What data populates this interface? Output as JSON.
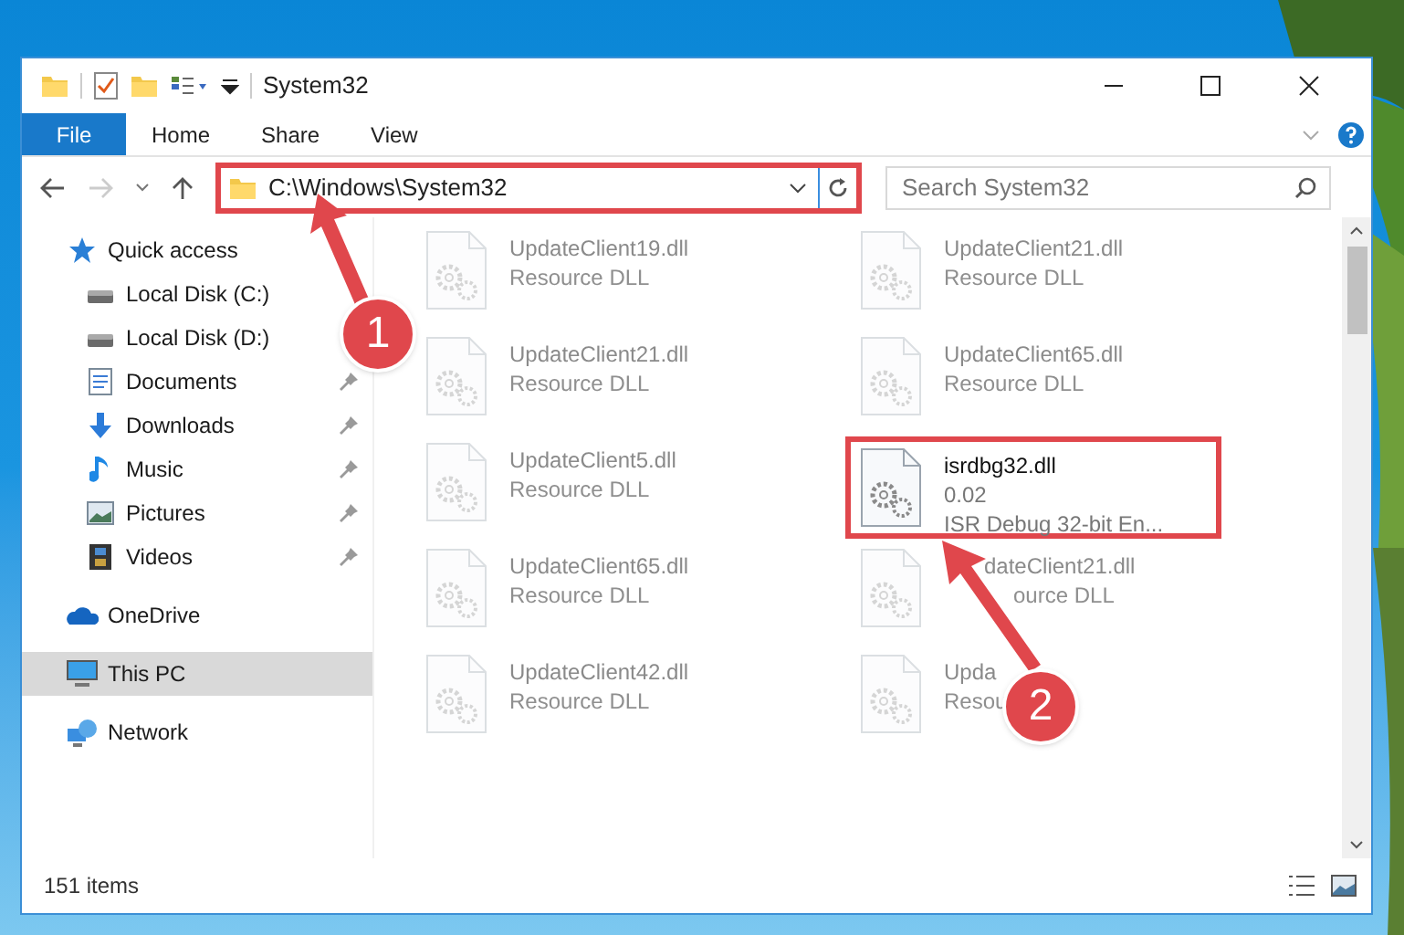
{
  "window": {
    "title": "System32"
  },
  "ribbon": {
    "tabs": [
      {
        "label": "File",
        "kind": "file"
      },
      {
        "label": "Home",
        "kind": "tab"
      },
      {
        "label": "Share",
        "kind": "tab"
      },
      {
        "label": "View",
        "kind": "tab"
      }
    ]
  },
  "address_bar": {
    "path": "C:\\Windows\\System32",
    "highlighted": true
  },
  "search": {
    "placeholder": "Search System32"
  },
  "sidebar": {
    "items": [
      {
        "label": "Quick access",
        "kind": "star",
        "selected": false,
        "children": [
          {
            "label": "Local Disk (C:)",
            "kind": "disk",
            "selected": false
          },
          {
            "label": "Local Disk (D:)",
            "kind": "disk",
            "selected": false
          },
          {
            "label": "Documents",
            "kind": "documents",
            "pinned": true,
            "selected": false
          },
          {
            "label": "Downloads",
            "kind": "downloads",
            "pinned": true,
            "selected": false
          },
          {
            "label": "Music",
            "kind": "music",
            "pinned": true,
            "selected": false
          },
          {
            "label": "Pictures",
            "kind": "pictures",
            "pinned": true,
            "selected": false
          },
          {
            "label": "Videos",
            "kind": "videos",
            "pinned": true,
            "selected": false
          }
        ]
      },
      {
        "label": "OneDrive",
        "kind": "cloud",
        "selected": false
      },
      {
        "label": "This PC",
        "kind": "pc",
        "selected": true
      },
      {
        "label": "Network",
        "kind": "network",
        "selected": false
      }
    ]
  },
  "files": [
    {
      "name": "UpdateClient19.dll",
      "description": "Resource DLL",
      "blurred": true,
      "highlighted": false
    },
    {
      "name": "UpdateClient21.dll",
      "description": "Resource DLL",
      "blurred": true,
      "highlighted": false
    },
    {
      "name": "UpdateClient21.dll",
      "description": "Resource DLL",
      "blurred": true,
      "highlighted": false
    },
    {
      "name": "UpdateClient65.dll",
      "description": "Resource DLL",
      "blurred": true,
      "highlighted": false
    },
    {
      "name": "UpdateClient5.dll",
      "description": "Resource DLL",
      "blurred": true,
      "highlighted": false
    },
    {
      "name": "isrdbg32.dll",
      "version": "0.02",
      "description": "ISR Debug 32-bit En...",
      "blurred": false,
      "highlighted": true
    },
    {
      "name": "UpdateClient65.dll",
      "description": "Resource DLL",
      "blurred": true,
      "highlighted": false
    },
    {
      "name": "dateClient21.dll",
      "description": "ource DLL",
      "blurred": true,
      "highlighted": false,
      "kind": "covered"
    },
    {
      "name": "UpdateClient42.dll",
      "description": "Resource DLL",
      "blurred": true,
      "highlighted": false
    },
    {
      "name": "Upda",
      "description": "Resou",
      "blurred": true,
      "highlighted": false
    }
  ],
  "status_bar": {
    "count": "151 items"
  },
  "callouts": [
    {
      "label": "1"
    },
    {
      "label": "2"
    }
  ]
}
